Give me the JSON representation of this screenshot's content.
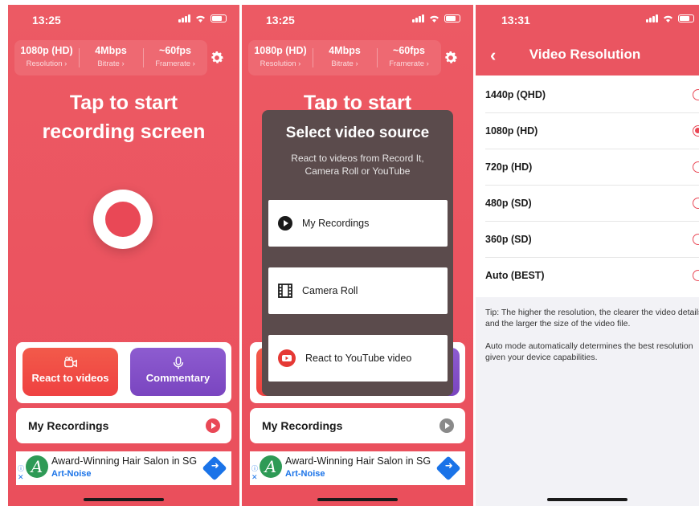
{
  "colors": {
    "brand_red": "#ea5561",
    "record_red": "#e94856",
    "react_orange": "#ef4141",
    "commentary_purple": "#7a45c0",
    "link_blue": "#1a73e8"
  },
  "screen1": {
    "time": "13:25",
    "stats": [
      {
        "value": "1080p (HD)",
        "label": "Resolution ›"
      },
      {
        "value": "4Mbps",
        "label": "Bitrate ›"
      },
      {
        "value": "~60fps",
        "label": "Framerate ›"
      }
    ],
    "headline": [
      "Tap to start",
      "recording screen"
    ],
    "react_label": "React to videos",
    "commentary_label": "Commentary",
    "my_recordings": "My Recordings",
    "ad": {
      "title": "Award-Winning Hair Salon in SG",
      "brand": "Art-Noise",
      "logo_letter": "A"
    }
  },
  "screen2": {
    "time": "13:25",
    "stats": [
      {
        "value": "1080p (HD)",
        "label": "Resolution ›"
      },
      {
        "value": "4Mbps",
        "label": "Bitrate ›"
      },
      {
        "value": "~60fps",
        "label": "Framerate ›"
      }
    ],
    "headline_peek": "Tap to start",
    "modal": {
      "title": "Select video source",
      "subtitle": "React to videos from Record It, Camera Roll or YouTube",
      "options": [
        {
          "label": "My Recordings",
          "icon": "play-circle-icon"
        },
        {
          "label": "Camera Roll",
          "icon": "film-icon"
        },
        {
          "label": "React to YouTube video",
          "icon": "youtube-icon"
        }
      ]
    },
    "my_recordings": "My Recordings",
    "ad": {
      "title": "Award-Winning Hair Salon in SG",
      "brand": "Art-Noise",
      "logo_letter": "A"
    }
  },
  "screen3": {
    "time": "13:31",
    "title": "Video Resolution",
    "options": [
      {
        "label": "1440p (QHD)",
        "selected": false
      },
      {
        "label": "1080p (HD)",
        "selected": true
      },
      {
        "label": "720p (HD)",
        "selected": false
      },
      {
        "label": "480p (SD)",
        "selected": false
      },
      {
        "label": "360p (SD)",
        "selected": false
      },
      {
        "label": "Auto (BEST)",
        "selected": false
      }
    ],
    "tip1": "Tip: The higher the resolution, the clearer the video details and the larger the size of the video file.",
    "tip2": "Auto mode automatically determines the best resolution given your device capabilities."
  }
}
